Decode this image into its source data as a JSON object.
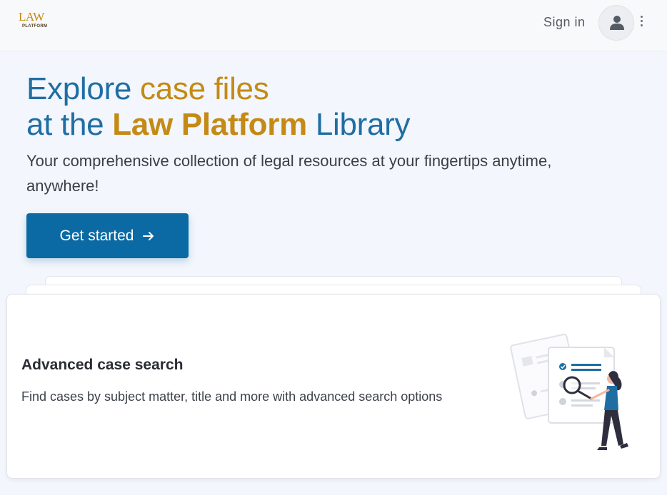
{
  "header": {
    "logo_main": "LAW",
    "logo_sub": "PLATFORM",
    "signin_label": "Sign in"
  },
  "hero": {
    "line1_part1": "Explore ",
    "line1_part2": "case files",
    "line2_part1": "at the ",
    "line2_part2": "Law Platform",
    "line2_part3": " Library",
    "subtitle": "Your comprehensive collection of legal resources at your fingertips anytime, anywhere!",
    "cta_label": "Get started"
  },
  "card": {
    "title": "Advanced case search",
    "description": "Find cases by subject matter, title and more with advanced search options"
  },
  "colors": {
    "primary": "#0b6aa3",
    "gold": "#c48a14",
    "background": "#f3f6fc"
  }
}
